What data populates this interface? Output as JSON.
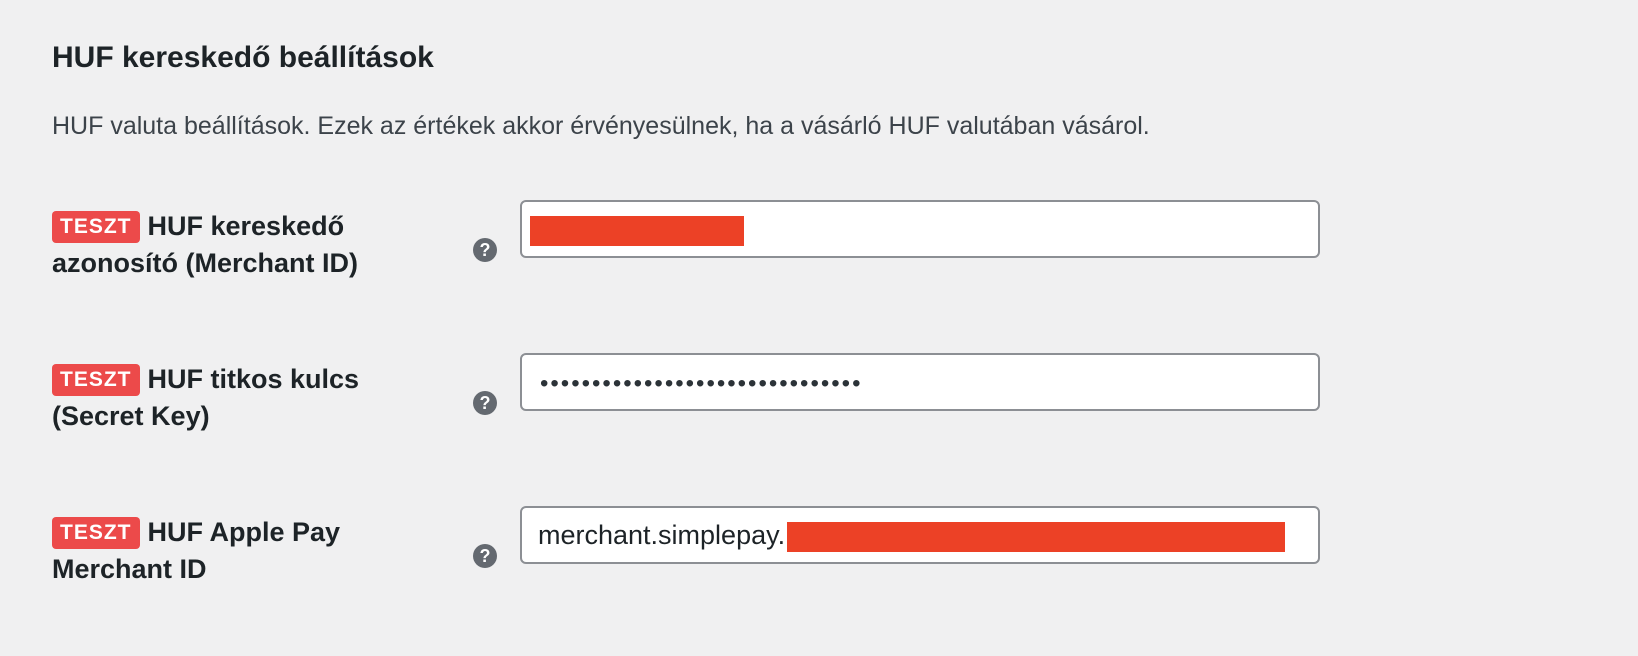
{
  "section": {
    "title": "HUF kereskedő beállítások",
    "description": "HUF valuta beállítások. Ezek az értékek akkor érvényesülnek, ha a vásárló HUF valutában vásárol."
  },
  "fields": [
    {
      "badge": "TESZT",
      "label": "HUF kereskedő azonosító (Merchant ID)",
      "help_icon": "question-circle-icon",
      "value": "",
      "value_redacted": true
    },
    {
      "badge": "TESZT",
      "label": "HUF titkos kulcs (Secret Key)",
      "help_icon": "question-circle-icon",
      "value": "•••••••••••••••••••••••••••••••",
      "masked": true
    },
    {
      "badge": "TESZT",
      "label": "HUF Apple Pay Merchant ID",
      "help_icon": "question-circle-icon",
      "value": "merchant.simplepay.",
      "value_redacted": true
    }
  ],
  "colors": {
    "background": "#f0f0f1",
    "badge": "#ec4a4a",
    "redaction": "#ec4126",
    "help_icon": "#646970",
    "field_border": "#8c8f94"
  }
}
